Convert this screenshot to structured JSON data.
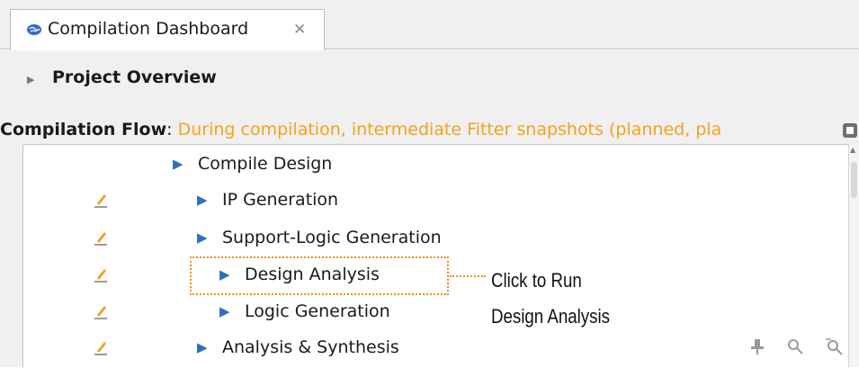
{
  "tab": {
    "title": "Compilation Dashboard",
    "close_glyph": "✕",
    "icon": "brain-icon"
  },
  "project_overview": {
    "label": "Project Overview",
    "expanded": false
  },
  "compilation_flow": {
    "label": "Compilation Flow",
    "separator": ": ",
    "message": "During compilation, intermediate Fitter snapshots (planned, pla"
  },
  "tree": {
    "triangle_glyph": "▶",
    "items": [
      {
        "label": "Compile Design",
        "level": 0,
        "has_edit_icon": false
      },
      {
        "label": "IP Generation",
        "level": 1,
        "has_edit_icon": true
      },
      {
        "label": "Support-Logic Generation",
        "level": 1,
        "has_edit_icon": true
      },
      {
        "label": "Design Analysis",
        "level": 2,
        "has_edit_icon": true
      },
      {
        "label": "Logic Generation",
        "level": 2,
        "has_edit_icon": true
      },
      {
        "label": "Analysis & Synthesis",
        "level": 1,
        "has_edit_icon": true
      }
    ]
  },
  "callout": {
    "line1": "Click to Run",
    "line2": "Design Analysis"
  },
  "toolbar_icons": [
    "pin-icon",
    "search-icon",
    "zoom-fit-icon"
  ],
  "colors": {
    "accent_orange": "#f5a21b",
    "highlight_orange": "#ef8d1c",
    "triangle_blue": "#2f6fbf"
  }
}
